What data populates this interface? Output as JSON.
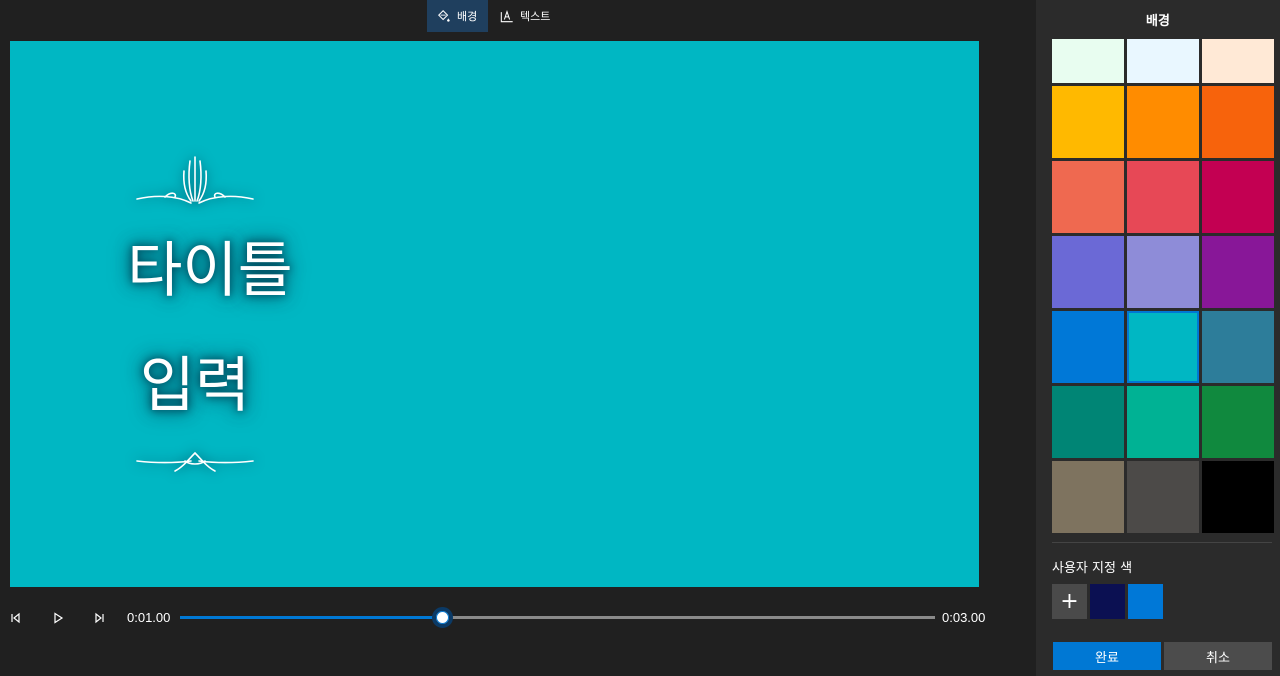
{
  "toolbar": {
    "tabs": [
      {
        "label": "배경",
        "icon": "paint-bucket-icon",
        "active": true
      },
      {
        "label": "텍스트",
        "icon": "text-box-icon",
        "active": false
      }
    ]
  },
  "preview": {
    "background": "#00b7c3",
    "title_line1": "타이틀",
    "title_line2": "입력"
  },
  "playback": {
    "current_time": "0:01.00",
    "total_time": "0:03.00",
    "progress": 0.3466
  },
  "panel": {
    "title": "배경",
    "swatches": [
      "#e8fdf0",
      "#e9f7ff",
      "#ffe9d6",
      "#ffb900",
      "#ff8c00",
      "#f7630c",
      "#ef6950",
      "#e74856",
      "#c30052",
      "#6b69d6",
      "#8e8cd8",
      "#881798",
      "#0078d7",
      "#00b7c3",
      "#2d7d9a",
      "#008575",
      "#00b294",
      "#10893e",
      "#7e735f",
      "#4c4a48",
      "#000000"
    ],
    "selected_swatch": "#00b7c3",
    "custom_label": "사용자 지정 색",
    "add_label": "+",
    "custom_colors": [
      "#0b1052",
      "#0078d7"
    ],
    "done_label": "완료",
    "cancel_label": "취소"
  }
}
